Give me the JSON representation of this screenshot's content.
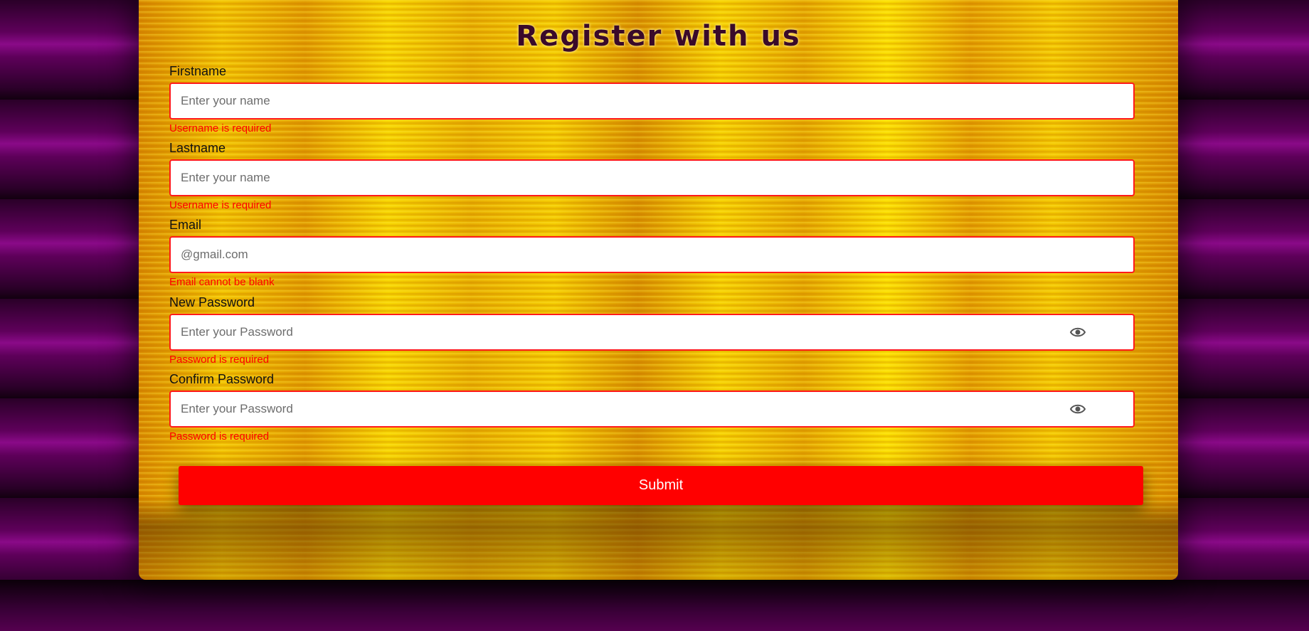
{
  "form": {
    "title": "Register with us",
    "fields": [
      {
        "label": "Firstname",
        "placeholder": "Enter your name",
        "value": "",
        "error": "Username is required"
      },
      {
        "label": "Lastname",
        "placeholder": "Enter your name",
        "value": "",
        "error": "Username is required"
      },
      {
        "label": "Email",
        "placeholder": "@gmail.com",
        "value": "",
        "error": "Email cannot be blank"
      },
      {
        "label": "New Password",
        "placeholder": "Enter your Password",
        "value": "",
        "error": "Password is required",
        "icon": "eye-icon"
      },
      {
        "label": "Confirm Password",
        "placeholder": "Enter your Password",
        "value": "",
        "error": "Password is required",
        "icon": "eye-icon"
      }
    ],
    "submit_label": "Submit"
  },
  "colors": {
    "error": "#ff0000",
    "submit_bg": "#ff0000",
    "input_border": "#ff1a1a",
    "title": "#3a0a2a",
    "page_bg": "#5e005a",
    "card_bg": "#e6a800"
  }
}
